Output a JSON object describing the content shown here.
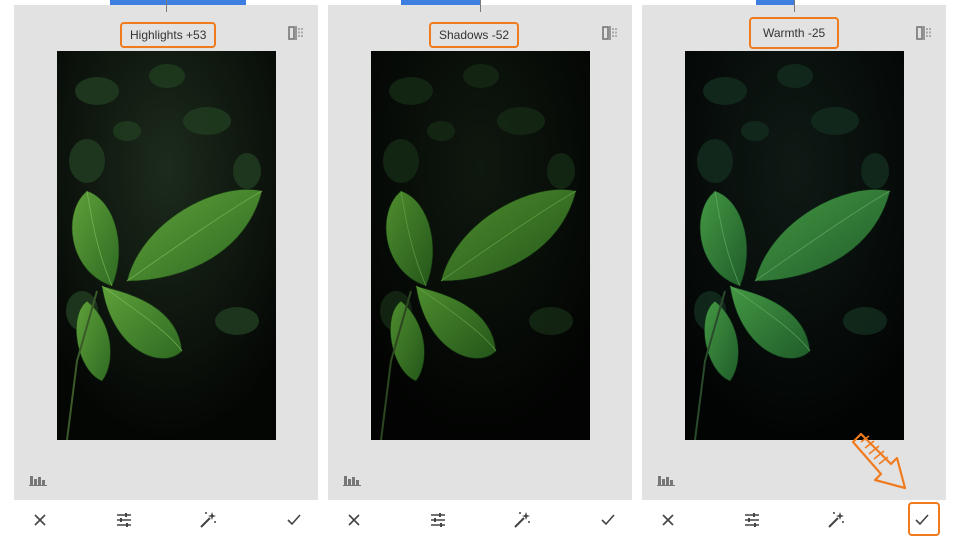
{
  "panels": [
    {
      "adjustment_label": "Highlights +53",
      "variant": "highlights"
    },
    {
      "adjustment_label": "Shadows -52",
      "variant": "shadows"
    },
    {
      "adjustment_label": "Warmth -25",
      "variant": "warmth"
    }
  ],
  "icons": {
    "compare": "compare-icon",
    "histogram": "histogram-icon",
    "cancel": "close-icon",
    "tune": "sliders-icon",
    "auto": "magic-wand-icon",
    "apply": "checkmark-icon"
  },
  "colors": {
    "accent_orange": "#f07b1e",
    "top_indicator_blue": "#3c7fe0",
    "panel_background": "#e2e2e2"
  }
}
